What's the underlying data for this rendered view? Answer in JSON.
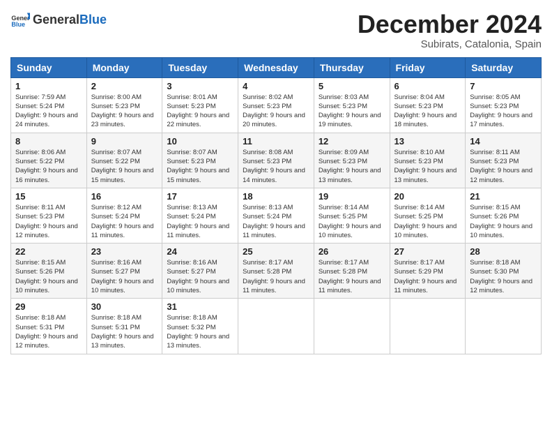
{
  "logo": {
    "general": "General",
    "blue": "Blue"
  },
  "header": {
    "month": "December 2024",
    "location": "Subirats, Catalonia, Spain"
  },
  "weekdays": [
    "Sunday",
    "Monday",
    "Tuesday",
    "Wednesday",
    "Thursday",
    "Friday",
    "Saturday"
  ],
  "weeks": [
    [
      {
        "day": "1",
        "sunrise": "Sunrise: 7:59 AM",
        "sunset": "Sunset: 5:24 PM",
        "daylight": "Daylight: 9 hours and 24 minutes."
      },
      {
        "day": "2",
        "sunrise": "Sunrise: 8:00 AM",
        "sunset": "Sunset: 5:23 PM",
        "daylight": "Daylight: 9 hours and 23 minutes."
      },
      {
        "day": "3",
        "sunrise": "Sunrise: 8:01 AM",
        "sunset": "Sunset: 5:23 PM",
        "daylight": "Daylight: 9 hours and 22 minutes."
      },
      {
        "day": "4",
        "sunrise": "Sunrise: 8:02 AM",
        "sunset": "Sunset: 5:23 PM",
        "daylight": "Daylight: 9 hours and 20 minutes."
      },
      {
        "day": "5",
        "sunrise": "Sunrise: 8:03 AM",
        "sunset": "Sunset: 5:23 PM",
        "daylight": "Daylight: 9 hours and 19 minutes."
      },
      {
        "day": "6",
        "sunrise": "Sunrise: 8:04 AM",
        "sunset": "Sunset: 5:23 PM",
        "daylight": "Daylight: 9 hours and 18 minutes."
      },
      {
        "day": "7",
        "sunrise": "Sunrise: 8:05 AM",
        "sunset": "Sunset: 5:23 PM",
        "daylight": "Daylight: 9 hours and 17 minutes."
      }
    ],
    [
      {
        "day": "8",
        "sunrise": "Sunrise: 8:06 AM",
        "sunset": "Sunset: 5:22 PM",
        "daylight": "Daylight: 9 hours and 16 minutes."
      },
      {
        "day": "9",
        "sunrise": "Sunrise: 8:07 AM",
        "sunset": "Sunset: 5:22 PM",
        "daylight": "Daylight: 9 hours and 15 minutes."
      },
      {
        "day": "10",
        "sunrise": "Sunrise: 8:07 AM",
        "sunset": "Sunset: 5:23 PM",
        "daylight": "Daylight: 9 hours and 15 minutes."
      },
      {
        "day": "11",
        "sunrise": "Sunrise: 8:08 AM",
        "sunset": "Sunset: 5:23 PM",
        "daylight": "Daylight: 9 hours and 14 minutes."
      },
      {
        "day": "12",
        "sunrise": "Sunrise: 8:09 AM",
        "sunset": "Sunset: 5:23 PM",
        "daylight": "Daylight: 9 hours and 13 minutes."
      },
      {
        "day": "13",
        "sunrise": "Sunrise: 8:10 AM",
        "sunset": "Sunset: 5:23 PM",
        "daylight": "Daylight: 9 hours and 13 minutes."
      },
      {
        "day": "14",
        "sunrise": "Sunrise: 8:11 AM",
        "sunset": "Sunset: 5:23 PM",
        "daylight": "Daylight: 9 hours and 12 minutes."
      }
    ],
    [
      {
        "day": "15",
        "sunrise": "Sunrise: 8:11 AM",
        "sunset": "Sunset: 5:23 PM",
        "daylight": "Daylight: 9 hours and 12 minutes."
      },
      {
        "day": "16",
        "sunrise": "Sunrise: 8:12 AM",
        "sunset": "Sunset: 5:24 PM",
        "daylight": "Daylight: 9 hours and 11 minutes."
      },
      {
        "day": "17",
        "sunrise": "Sunrise: 8:13 AM",
        "sunset": "Sunset: 5:24 PM",
        "daylight": "Daylight: 9 hours and 11 minutes."
      },
      {
        "day": "18",
        "sunrise": "Sunrise: 8:13 AM",
        "sunset": "Sunset: 5:24 PM",
        "daylight": "Daylight: 9 hours and 11 minutes."
      },
      {
        "day": "19",
        "sunrise": "Sunrise: 8:14 AM",
        "sunset": "Sunset: 5:25 PM",
        "daylight": "Daylight: 9 hours and 10 minutes."
      },
      {
        "day": "20",
        "sunrise": "Sunrise: 8:14 AM",
        "sunset": "Sunset: 5:25 PM",
        "daylight": "Daylight: 9 hours and 10 minutes."
      },
      {
        "day": "21",
        "sunrise": "Sunrise: 8:15 AM",
        "sunset": "Sunset: 5:26 PM",
        "daylight": "Daylight: 9 hours and 10 minutes."
      }
    ],
    [
      {
        "day": "22",
        "sunrise": "Sunrise: 8:15 AM",
        "sunset": "Sunset: 5:26 PM",
        "daylight": "Daylight: 9 hours and 10 minutes."
      },
      {
        "day": "23",
        "sunrise": "Sunrise: 8:16 AM",
        "sunset": "Sunset: 5:27 PM",
        "daylight": "Daylight: 9 hours and 10 minutes."
      },
      {
        "day": "24",
        "sunrise": "Sunrise: 8:16 AM",
        "sunset": "Sunset: 5:27 PM",
        "daylight": "Daylight: 9 hours and 10 minutes."
      },
      {
        "day": "25",
        "sunrise": "Sunrise: 8:17 AM",
        "sunset": "Sunset: 5:28 PM",
        "daylight": "Daylight: 9 hours and 11 minutes."
      },
      {
        "day": "26",
        "sunrise": "Sunrise: 8:17 AM",
        "sunset": "Sunset: 5:28 PM",
        "daylight": "Daylight: 9 hours and 11 minutes."
      },
      {
        "day": "27",
        "sunrise": "Sunrise: 8:17 AM",
        "sunset": "Sunset: 5:29 PM",
        "daylight": "Daylight: 9 hours and 11 minutes."
      },
      {
        "day": "28",
        "sunrise": "Sunrise: 8:18 AM",
        "sunset": "Sunset: 5:30 PM",
        "daylight": "Daylight: 9 hours and 12 minutes."
      }
    ],
    [
      {
        "day": "29",
        "sunrise": "Sunrise: 8:18 AM",
        "sunset": "Sunset: 5:31 PM",
        "daylight": "Daylight: 9 hours and 12 minutes."
      },
      {
        "day": "30",
        "sunrise": "Sunrise: 8:18 AM",
        "sunset": "Sunset: 5:31 PM",
        "daylight": "Daylight: 9 hours and 13 minutes."
      },
      {
        "day": "31",
        "sunrise": "Sunrise: 8:18 AM",
        "sunset": "Sunset: 5:32 PM",
        "daylight": "Daylight: 9 hours and 13 minutes."
      },
      null,
      null,
      null,
      null
    ]
  ]
}
